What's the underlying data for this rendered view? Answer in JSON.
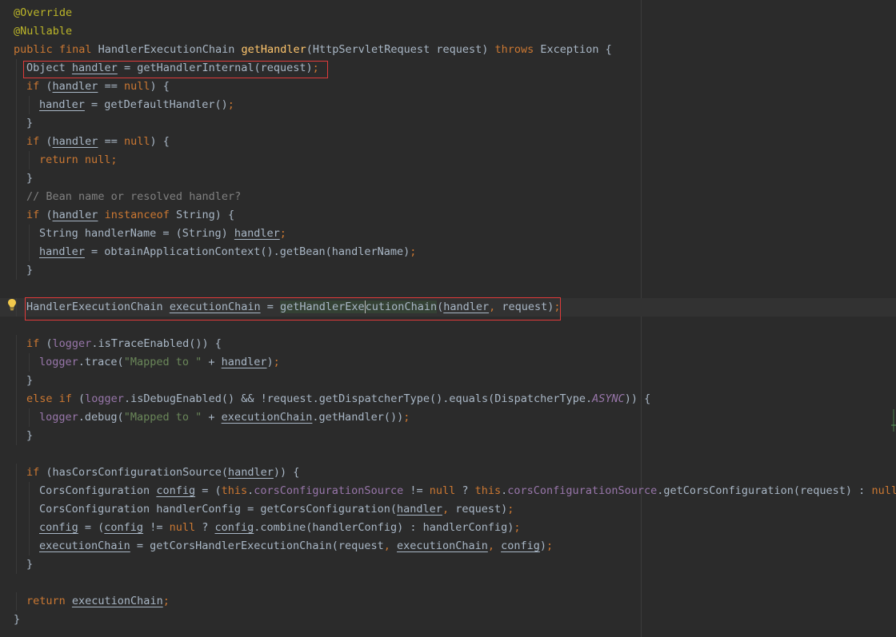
{
  "editor": {
    "colors": {
      "background": "#2b2b2b",
      "keyword": "#cc7832",
      "annotation": "#bbb529",
      "method_decl": "#ffc66d",
      "field": "#9876aa",
      "string": "#6a8759",
      "comment": "#808080",
      "default_text": "#a9b7c6",
      "highlight_box": "#e03b3b"
    },
    "gutter_icons": [
      "lightbulb-icon",
      "change-marker-icon"
    ],
    "lines": [
      {
        "indent": 0,
        "tokens": [
          [
            "ann",
            "@Override"
          ]
        ]
      },
      {
        "indent": 0,
        "tokens": [
          [
            "ann",
            "@Nullable"
          ]
        ]
      },
      {
        "indent": 0,
        "tokens": [
          [
            "kw",
            "public final "
          ],
          [
            "id",
            "HandlerExecutionChain "
          ],
          [
            "fn",
            "getHandler"
          ],
          [
            "p",
            "(HttpServletRequest request) "
          ],
          [
            "kw",
            "throws "
          ],
          [
            "id",
            "Exception {"
          ]
        ]
      },
      {
        "indent": 1,
        "tokens": [
          [
            "id",
            "Object "
          ],
          [
            "var",
            "handler"
          ],
          [
            "p",
            " = getHandlerInternal(request)"
          ],
          [
            "kw",
            ";"
          ]
        ]
      },
      {
        "indent": 1,
        "tokens": [
          [
            "kw",
            "if "
          ],
          [
            "p",
            "("
          ],
          [
            "var",
            "handler"
          ],
          [
            "p",
            " == "
          ],
          [
            "kw",
            "null"
          ],
          [
            "p",
            ") {"
          ]
        ]
      },
      {
        "indent": 2,
        "tokens": [
          [
            "var",
            "handler"
          ],
          [
            "p",
            " = getDefaultHandler()"
          ],
          [
            "kw",
            ";"
          ]
        ]
      },
      {
        "indent": 1,
        "tokens": [
          [
            "p",
            "}"
          ]
        ]
      },
      {
        "indent": 1,
        "tokens": [
          [
            "kw",
            "if "
          ],
          [
            "p",
            "("
          ],
          [
            "var",
            "handler"
          ],
          [
            "p",
            " == "
          ],
          [
            "kw",
            "null"
          ],
          [
            "p",
            ") {"
          ]
        ]
      },
      {
        "indent": 2,
        "tokens": [
          [
            "kw",
            "return null;"
          ]
        ]
      },
      {
        "indent": 1,
        "tokens": [
          [
            "p",
            "}"
          ]
        ]
      },
      {
        "indent": 1,
        "tokens": [
          [
            "cm",
            "// Bean name or resolved handler?"
          ]
        ]
      },
      {
        "indent": 1,
        "tokens": [
          [
            "kw",
            "if "
          ],
          [
            "p",
            "("
          ],
          [
            "var",
            "handler"
          ],
          [
            "kw",
            " instanceof "
          ],
          [
            "p",
            "String) {"
          ]
        ]
      },
      {
        "indent": 2,
        "tokens": [
          [
            "id",
            "String handlerName = (String) "
          ],
          [
            "var",
            "handler"
          ],
          [
            "kw",
            ";"
          ]
        ]
      },
      {
        "indent": 2,
        "tokens": [
          [
            "var",
            "handler"
          ],
          [
            "p",
            " = obtainApplicationContext().getBean(handlerName)"
          ],
          [
            "kw",
            ";"
          ]
        ]
      },
      {
        "indent": 1,
        "tokens": [
          [
            "p",
            "}"
          ]
        ]
      },
      {
        "indent": 0,
        "tokens": []
      },
      {
        "indent": 1,
        "current": true,
        "tokens": [
          [
            "id",
            "HandlerExecutionChain "
          ],
          [
            "var",
            "executionChain"
          ],
          [
            "p",
            " = "
          ],
          [
            "hl",
            "getHandlerExe"
          ],
          [
            "caret",
            ""
          ],
          [
            "hl",
            "cutionChain"
          ],
          [
            "p",
            "("
          ],
          [
            "var",
            "handler"
          ],
          [
            "kw",
            ", "
          ],
          [
            "p",
            "request)"
          ],
          [
            "kw",
            ";"
          ]
        ]
      },
      {
        "indent": 0,
        "tokens": []
      },
      {
        "indent": 1,
        "tokens": [
          [
            "kw",
            "if "
          ],
          [
            "p",
            "("
          ],
          [
            "field",
            "logger"
          ],
          [
            "p",
            ".isTraceEnabled()) {"
          ]
        ]
      },
      {
        "indent": 2,
        "tokens": [
          [
            "field",
            "logger"
          ],
          [
            "p",
            ".trace("
          ],
          [
            "str",
            "\"Mapped to \""
          ],
          [
            "p",
            " + "
          ],
          [
            "var",
            "handler"
          ],
          [
            "p",
            ")"
          ],
          [
            "kw",
            ";"
          ]
        ]
      },
      {
        "indent": 1,
        "tokens": [
          [
            "p",
            "}"
          ]
        ]
      },
      {
        "indent": 1,
        "tokens": [
          [
            "kw",
            "else if "
          ],
          [
            "p",
            "("
          ],
          [
            "field",
            "logger"
          ],
          [
            "p",
            ".isDebugEnabled() && !request.getDispatcherType().equals(DispatcherType."
          ],
          [
            "italic",
            "ASYNC"
          ],
          [
            "p",
            ")) {"
          ]
        ]
      },
      {
        "indent": 2,
        "tokens": [
          [
            "field",
            "logger"
          ],
          [
            "p",
            ".debug("
          ],
          [
            "str",
            "\"Mapped to \""
          ],
          [
            "p",
            " + "
          ],
          [
            "var",
            "executionChain"
          ],
          [
            "p",
            ".getHandler())"
          ],
          [
            "kw",
            ";"
          ]
        ]
      },
      {
        "indent": 1,
        "tokens": [
          [
            "p",
            "}"
          ]
        ]
      },
      {
        "indent": 0,
        "tokens": []
      },
      {
        "indent": 1,
        "tokens": [
          [
            "kw",
            "if "
          ],
          [
            "p",
            "(hasCorsConfigurationSource("
          ],
          [
            "var",
            "handler"
          ],
          [
            "p",
            ")) {"
          ]
        ]
      },
      {
        "indent": 2,
        "tokens": [
          [
            "id",
            "CorsConfiguration "
          ],
          [
            "var",
            "config"
          ],
          [
            "p",
            " = ("
          ],
          [
            "kw",
            "this"
          ],
          [
            "p",
            "."
          ],
          [
            "field",
            "corsConfigurationSource"
          ],
          [
            "p",
            " != "
          ],
          [
            "kw",
            "null "
          ],
          [
            "p",
            "? "
          ],
          [
            "kw",
            "this"
          ],
          [
            "p",
            "."
          ],
          [
            "field",
            "corsConfigurationSource"
          ],
          [
            "p",
            ".getCorsConfiguration(request) : "
          ],
          [
            "kw",
            "null"
          ],
          [
            "p",
            ")"
          ],
          [
            "kw",
            ";"
          ]
        ]
      },
      {
        "indent": 2,
        "tokens": [
          [
            "id",
            "CorsConfiguration handlerConfig = getCorsConfiguration("
          ],
          [
            "var",
            "handler"
          ],
          [
            "kw",
            ", "
          ],
          [
            "p",
            "request)"
          ],
          [
            "kw",
            ";"
          ]
        ]
      },
      {
        "indent": 2,
        "tokens": [
          [
            "var",
            "config"
          ],
          [
            "p",
            " = ("
          ],
          [
            "var",
            "config"
          ],
          [
            "p",
            " != "
          ],
          [
            "kw",
            "null "
          ],
          [
            "p",
            "? "
          ],
          [
            "var",
            "config"
          ],
          [
            "p",
            ".combine(handlerConfig) : handlerConfig)"
          ],
          [
            "kw",
            ";"
          ]
        ]
      },
      {
        "indent": 2,
        "tokens": [
          [
            "var",
            "executionChain"
          ],
          [
            "p",
            " = getCorsHandlerExecutionChain(request"
          ],
          [
            "kw",
            ", "
          ],
          [
            "var",
            "executionChain"
          ],
          [
            "kw",
            ", "
          ],
          [
            "var",
            "config"
          ],
          [
            "p",
            ")"
          ],
          [
            "kw",
            ";"
          ]
        ]
      },
      {
        "indent": 1,
        "tokens": [
          [
            "p",
            "}"
          ]
        ]
      },
      {
        "indent": 0,
        "tokens": []
      },
      {
        "indent": 1,
        "tokens": [
          [
            "kw",
            "return "
          ],
          [
            "var",
            "executionChain"
          ],
          [
            "kw",
            ";"
          ]
        ]
      },
      {
        "indent": 0,
        "tokens": [
          [
            "p",
            "}"
          ]
        ]
      }
    ]
  }
}
